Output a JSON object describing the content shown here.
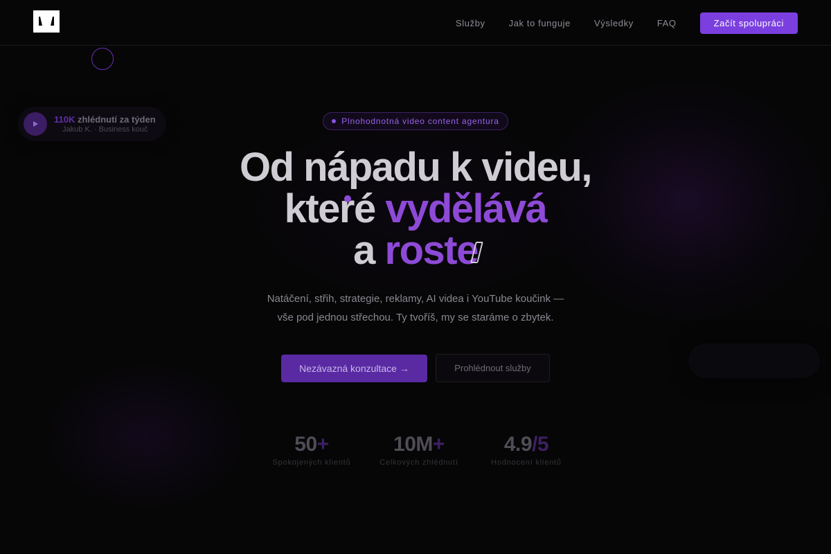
{
  "header": {
    "logo": "M",
    "nav": [
      {
        "label": "Služby"
      },
      {
        "label": "Jak to funguje"
      },
      {
        "label": "Výsledky"
      },
      {
        "label": "FAQ"
      }
    ],
    "cta_label": "Začít spolupráci"
  },
  "float_card": {
    "avatar_icon": "play-icon",
    "highlight": "110K",
    "title_rest": " zhlédnutí za týden",
    "subtitle": "Jakub K. · Business kouč"
  },
  "hero": {
    "badge": "Plnohodnotná video content agentura",
    "line1": "Od nápadu k videu,",
    "line2_plain": "které ",
    "line2_accent": "vydělává",
    "line3_plain": "a ",
    "line3_accent": "roste",
    "subtitle_line1": "Natáčení, střih, strategie, reklamy, AI videa i YouTube koučink —",
    "subtitle_line2": "vše pod jednou střechou. Ty tvoříš, my se staráme o zbytek.",
    "primary_button": "Nezávazná konzultace →",
    "secondary_button": "Prohlédnout služby"
  },
  "stats": [
    {
      "value": "50",
      "suffix": "+",
      "label": "Spokojených klientů"
    },
    {
      "value": "10M",
      "suffix": "+",
      "label": "Celkových zhlédnutí"
    },
    {
      "value": "4.9",
      "suffix": "/5",
      "label": "Hodnocení klientů"
    }
  ],
  "colors": {
    "accent": "#7b3fe0",
    "accent_text": "#8d4ad6",
    "background": "#060606"
  }
}
